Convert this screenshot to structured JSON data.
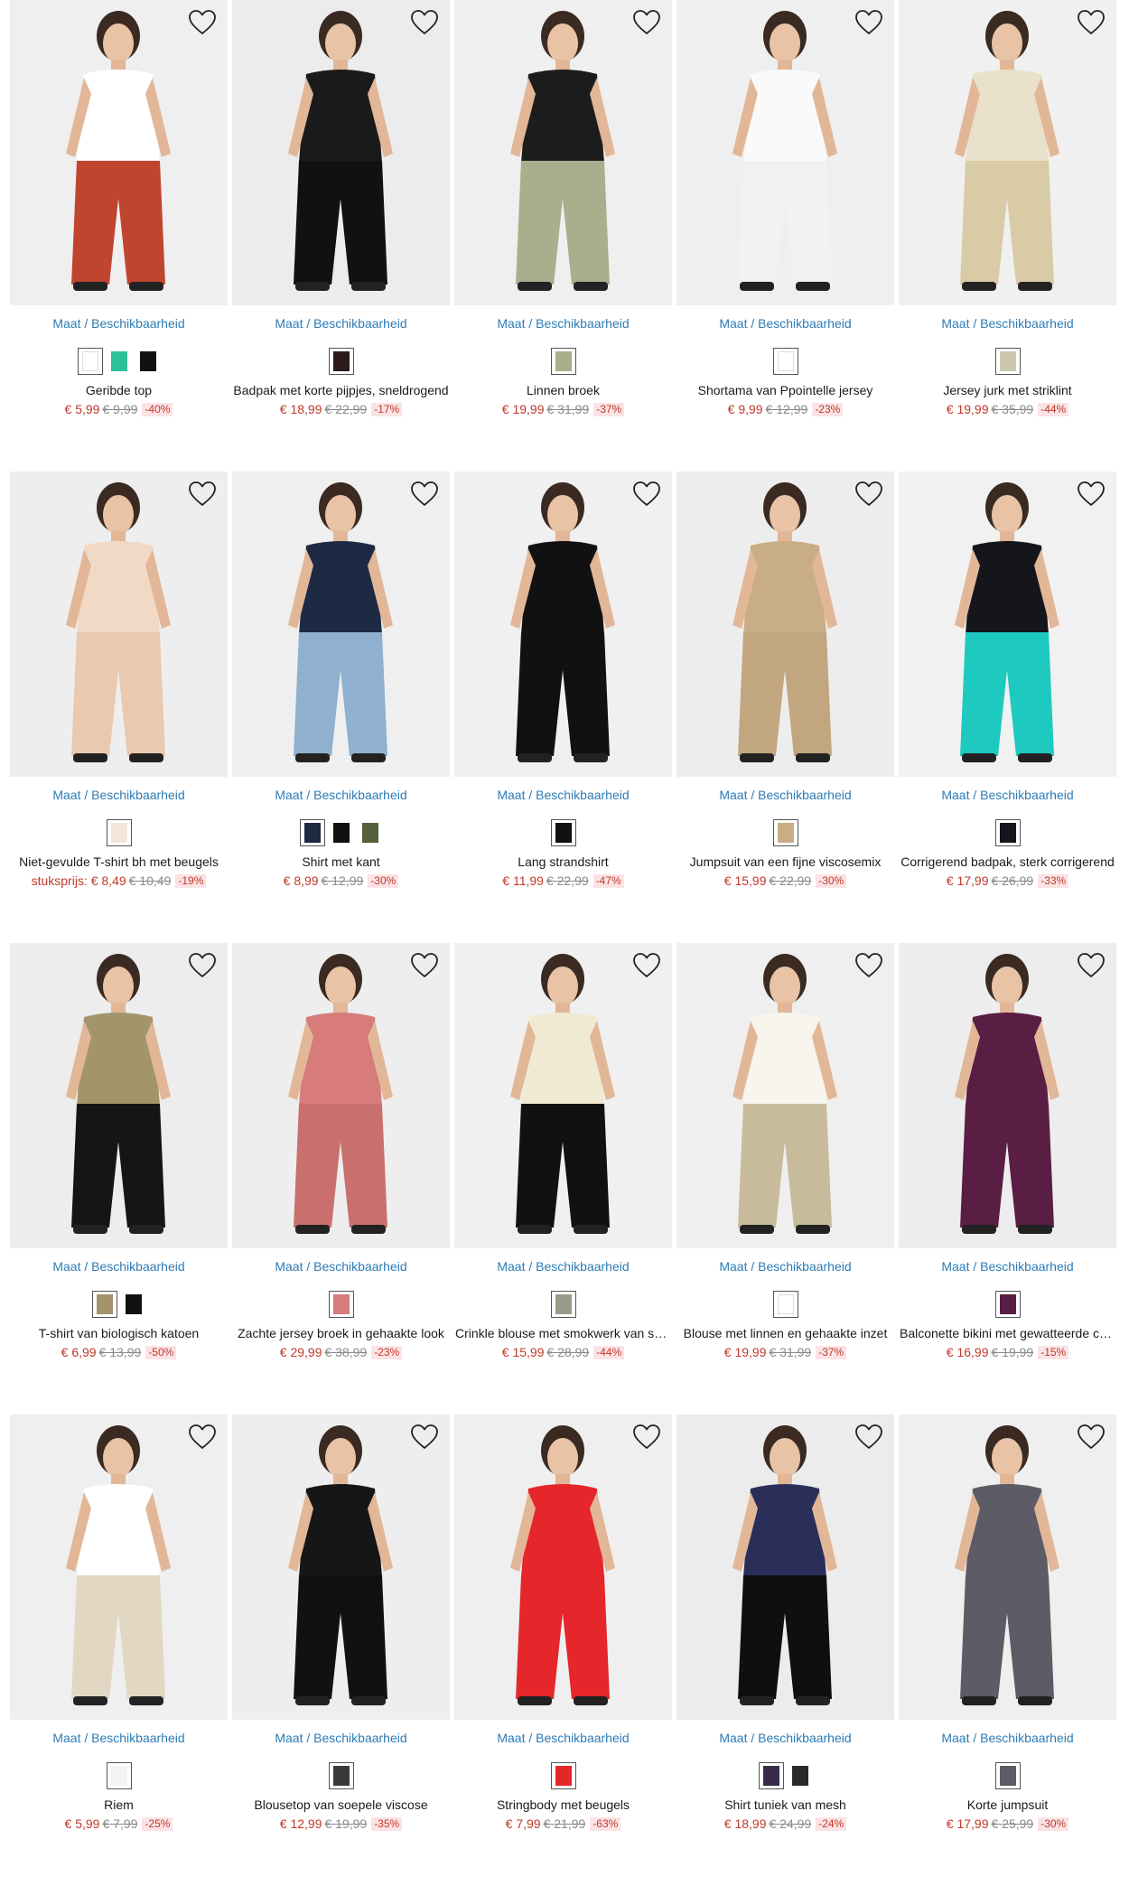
{
  "availability_label": "Maat / Beschikbaarheid",
  "colors": {
    "link": "#2d7bb5",
    "sale": "#c0392b",
    "badge_bg": "#fbe3e5",
    "old_price": "#8a8a8a"
  },
  "products": [
    {
      "title": "Geribde top",
      "prefix": "",
      "price": "€ 5,99",
      "old": "€ 9,99",
      "discount": "-40%",
      "bg": "#efefef",
      "top": "#ffffff",
      "bottom": "#c0452f",
      "swatches": [
        "#ffffff",
        "#2fbf9a",
        "#111111"
      ]
    },
    {
      "title": "Badpak met korte pijpjes, sneldrogend",
      "prefix": "",
      "price": "€ 18,99",
      "old": "€ 22,99",
      "discount": "-17%",
      "bg": "#ececec",
      "top": "#1a1a1a",
      "bottom": "#111111",
      "swatches": [
        "#2a1a1a"
      ]
    },
    {
      "title": "Linnen broek",
      "prefix": "",
      "price": "€ 19,99",
      "old": "€ 31,99",
      "discount": "-37%",
      "bg": "#efefef",
      "top": "#1c1c1c",
      "bottom": "#a9ae8c",
      "swatches": [
        "#a9ae8c"
      ]
    },
    {
      "title": "Shortama van Ppointelle jersey",
      "prefix": "",
      "price": "€ 9,99",
      "old": "€ 12,99",
      "discount": "-23%",
      "bg": "#efefef",
      "top": "#fafafa",
      "bottom": "#f2f2f2",
      "swatches": [
        "#ffffff"
      ]
    },
    {
      "title": "Jersey jurk met striklint",
      "prefix": "",
      "price": "€ 19,99",
      "old": "€ 35,99",
      "discount": "-44%",
      "bg": "#f0f0f0",
      "top": "#e9e1c9",
      "bottom": "#d8cba5",
      "swatches": [
        "#cfc7ad"
      ]
    },
    {
      "title": "Niet-gevulde T-shirt bh met beugels",
      "prefix": "stuksprijs: ",
      "price": "€ 8,49",
      "old": "€ 10,49",
      "discount": "-19%",
      "bg": "#eeeeee",
      "top": "#f2d9c6",
      "bottom": "#e9c9b0",
      "swatches": [
        "#f2e6dc"
      ]
    },
    {
      "title": "Shirt met kant",
      "prefix": "",
      "price": "€ 8,99",
      "old": "€ 12,99",
      "discount": "-30%",
      "bg": "#efefef",
      "top": "#1e2a44",
      "bottom": "#8fb1cf",
      "swatches": [
        "#1e2a44",
        "#111111",
        "#55603a"
      ]
    },
    {
      "title": "Lang strandshirt",
      "prefix": "",
      "price": "€ 11,99",
      "old": "€ 22,99",
      "discount": "-47%",
      "bg": "#f0f0f0",
      "top": "#111111",
      "bottom": "#111111",
      "swatches": [
        "#111111"
      ]
    },
    {
      "title": "Jumpsuit van een fijne viscosemix",
      "prefix": "",
      "price": "€ 15,99",
      "old": "€ 22,99",
      "discount": "-30%",
      "bg": "#ededed",
      "top": "#c9ad86",
      "bottom": "#c2a67f",
      "swatches": [
        "#c9ad86"
      ]
    },
    {
      "title": "Corrigerend badpak, sterk corrigerend",
      "prefix": "",
      "price": "€ 17,99",
      "old": "€ 26,99",
      "discount": "-33%",
      "bg": "#f1f1f1",
      "top": "#15151c",
      "bottom": "#1ec9c0",
      "swatches": [
        "#15151c"
      ]
    },
    {
      "title": "T-shirt van biologisch katoen",
      "prefix": "",
      "price": "€ 6,99",
      "old": "€ 13,99",
      "discount": "-50%",
      "bg": "#ededed",
      "top": "#a4946c",
      "bottom": "#151515",
      "swatches": [
        "#a4946c",
        "#111111"
      ]
    },
    {
      "title": "Zachte jersey broek in gehaakte look",
      "prefix": "",
      "price": "€ 29,99",
      "old": "€ 38,99",
      "discount": "-23%",
      "bg": "#eeeeee",
      "top": "#d77b7b",
      "bottom": "#c9706e",
      "swatches": [
        "#d77b7b"
      ]
    },
    {
      "title": "Crinkle blouse met smokwerk van satijn",
      "prefix": "",
      "price": "€ 15,99",
      "old": "€ 28,99",
      "discount": "-44%",
      "bg": "#f0f0f0",
      "top": "#f1ead2",
      "bottom": "#111111",
      "swatches": [
        "#9a9a8a"
      ]
    },
    {
      "title": "Blouse met linnen en gehaakte inzet",
      "prefix": "",
      "price": "€ 19,99",
      "old": "€ 31,99",
      "discount": "-37%",
      "bg": "#efefef",
      "top": "#f7f5ee",
      "bottom": "#c8bb9c",
      "swatches": [
        "#ffffff"
      ]
    },
    {
      "title": "Balconette bikini met gewatteerde cups",
      "prefix": "",
      "price": "€ 16,99",
      "old": "€ 19,99",
      "discount": "-15%",
      "bg": "#ededed",
      "top": "#5a1d44",
      "bottom": "#5a1d44",
      "swatches": [
        "#5a1d44"
      ]
    },
    {
      "title": "Riem",
      "prefix": "",
      "price": "€ 5,99",
      "old": "€ 7,99",
      "discount": "-25%",
      "bg": "#efefef",
      "top": "#ffffff",
      "bottom": "#e2d7c2",
      "swatches": [
        "#f3f3f3"
      ]
    },
    {
      "title": "Blousetop van soepele viscose",
      "prefix": "",
      "price": "€ 12,99",
      "old": "€ 19,99",
      "discount": "-35%",
      "bg": "#eeeeee",
      "top": "#161616",
      "bottom": "#111111",
      "swatches": [
        "#3a3a3a"
      ]
    },
    {
      "title": "Stringbody met beugels",
      "prefix": "",
      "price": "€ 7,99",
      "old": "€ 21,99",
      "discount": "-63%",
      "bg": "#efefef",
      "top": "#e5262b",
      "bottom": "#e5262b",
      "swatches": [
        "#e5262b"
      ]
    },
    {
      "title": "Shirt tuniek van mesh",
      "prefix": "",
      "price": "€ 18,99",
      "old": "€ 24,99",
      "discount": "-24%",
      "bg": "#ececec",
      "top": "#2a2f5a",
      "bottom": "#0f0f0f",
      "swatches": [
        "#3a2a4a",
        "#2a2a2a"
      ]
    },
    {
      "title": "Korte jumpsuit",
      "prefix": "",
      "price": "€ 17,99",
      "old": "€ 25,99",
      "discount": "-30%",
      "bg": "#efefef",
      "top": "#5c5b66",
      "bottom": "#5c5b66",
      "swatches": [
        "#5c5b66"
      ]
    }
  ]
}
